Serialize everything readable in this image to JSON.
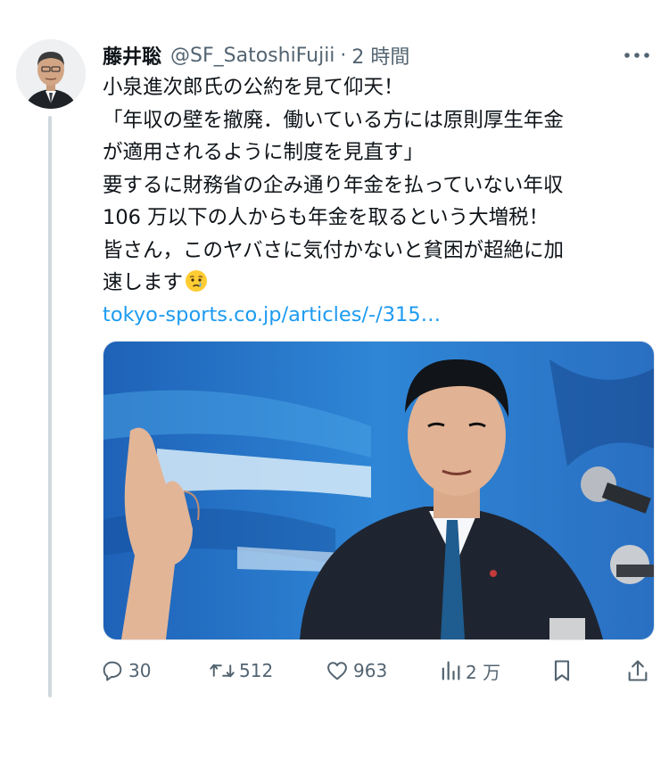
{
  "tweet": {
    "display_name": "藤井聡",
    "handle": "@SF_SatoshiFujii",
    "separator": "·",
    "time": "2 時間",
    "text_lines": [
      "小泉進次郎氏の公約を見て仰天！",
      "「年収の壁を撤廃．働いている方には原則厚生年金",
      "が適用されるように制度を見直す」",
      "要するに財務省の企み通り年金を払っていない年収",
      "106 万以下の人からも年金を取るという大増税！",
      "皆さん，このヤバさに気付かないと貧困が超絶に加",
      "速します"
    ],
    "link_text": "tokyo-sports.co.jp/articles/-/315…"
  },
  "actions": {
    "reply": {
      "icon": "reply-icon",
      "count": "30"
    },
    "retweet": {
      "icon": "retweet-icon",
      "count": "512"
    },
    "like": {
      "icon": "heart-icon",
      "count": "963"
    },
    "views": {
      "icon": "views-icon",
      "count": "2 万"
    },
    "bookmark": {
      "icon": "bookmark-icon"
    },
    "share": {
      "icon": "share-icon"
    }
  },
  "colors": {
    "text": "#0f1419",
    "secondary": "#536471",
    "link": "#1d9bf0",
    "thread_line": "#cfd9de"
  }
}
